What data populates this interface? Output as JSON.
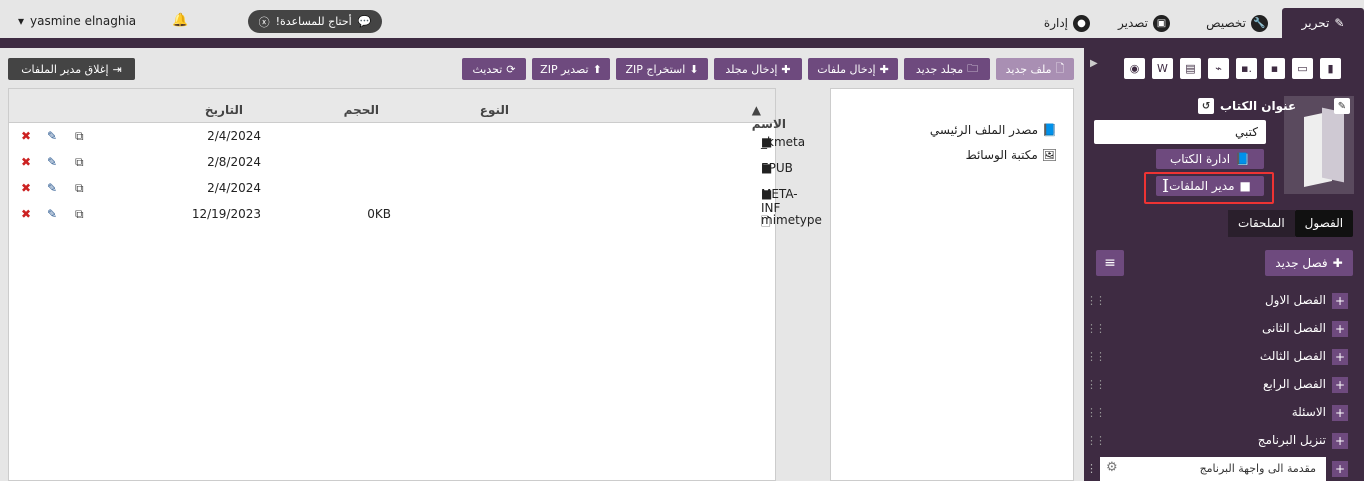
{
  "topbar": {
    "user_name": "yasmine elnaghia",
    "help_label": "أحتاج للمساعدة!",
    "tabs": [
      {
        "label": "تحرير",
        "icon": "pencil-icon"
      },
      {
        "label": "تخصيص",
        "icon": "wrench-icon"
      },
      {
        "label": "تصدير",
        "icon": "export-icon"
      },
      {
        "label": "إدارة",
        "icon": "user-icon"
      }
    ]
  },
  "toolbar": {
    "new_file": "ملف جديد",
    "new_folder": "مجلد جديد",
    "insert_files": "إدخال ملفات",
    "insert_folder": "إدخال مجلد",
    "extract_zip": "استخراج ZIP",
    "export_zip": "تصدير ZIP",
    "refresh": "تحديث",
    "close_file_manager": "إغلاق مدير الملفات"
  },
  "tree": {
    "items": [
      {
        "label": "مصدر الملف الرئيسي",
        "icon": "book-icon"
      },
      {
        "label": "مكتبة الوسائط",
        "icon": "image-icon"
      }
    ]
  },
  "file_table": {
    "columns": {
      "name": "الاسم",
      "type": "النوع",
      "size": "الحجم",
      "date": "التاريخ"
    },
    "rows": [
      {
        "name": "_kmeta",
        "type": "",
        "size": "",
        "date": "2/4/2024",
        "icon": "folder-icon"
      },
      {
        "name": "EPUB",
        "type": "",
        "size": "",
        "date": "2/8/2024",
        "icon": "folder-icon"
      },
      {
        "name": "META-INF",
        "type": "",
        "size": "",
        "date": "2/4/2024",
        "icon": "folder-icon"
      },
      {
        "name": "mimetype",
        "type": "",
        "size": "0KB",
        "date": "12/19/2023",
        "icon": "file-icon"
      }
    ]
  },
  "sidebar": {
    "book_title": "عنوان الكتاب",
    "book_tag": "كتبي",
    "book_management": "ادارة الكتاب",
    "file_manager": "مدير الملفات",
    "tab_chapters": "الفصول",
    "tab_appendices": "الملحقات",
    "new_chapter": "فصل جديد",
    "chapters": [
      "الفصل الاول",
      "الفصل الثانى",
      "الفصل الثالث",
      "الفصل الرابع",
      "الاسئلة",
      "تنزيل البرنامج"
    ],
    "last_chapter": "مقدمة الى واجهة البرنامج"
  }
}
